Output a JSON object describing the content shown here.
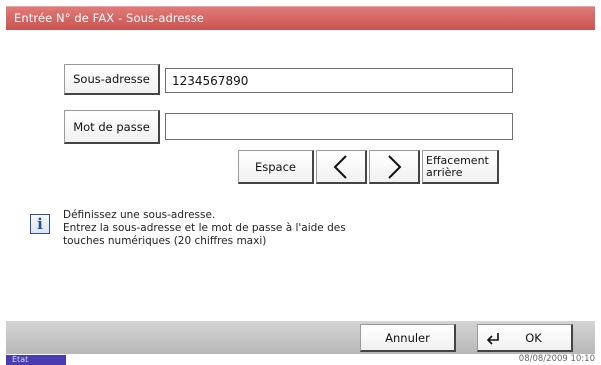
{
  "window": {
    "title": "Entrée N° de FAX - Sous-adresse"
  },
  "subaddress": {
    "button_label": "Sous-adresse",
    "value": "1234567890"
  },
  "password": {
    "button_label": "Mot de passe",
    "value": ""
  },
  "keys": {
    "space_label": "Espace",
    "left_icon": "chevron-left-icon",
    "right_icon": "chevron-right-icon",
    "backspace_label_line1": "Effacement",
    "backspace_label_line2": "arrière"
  },
  "info": {
    "icon": "info-icon",
    "line1": "Définissez une sous-adresse.",
    "line2": "Entrez la sous-adresse et le mot de passe à l'aide des",
    "line3": "touches numériques (20 chiffres maxi)"
  },
  "footer": {
    "cancel_label": "Annuler",
    "ok_label": "OK",
    "ok_icon": "enter-icon"
  },
  "status": {
    "state_label": "État",
    "datetime": "08/08/2009   10:10"
  },
  "colors": {
    "title_bar": "#d0605d",
    "status_state": "#4a3cb0",
    "bottom_bar": "#c4c4c4"
  }
}
